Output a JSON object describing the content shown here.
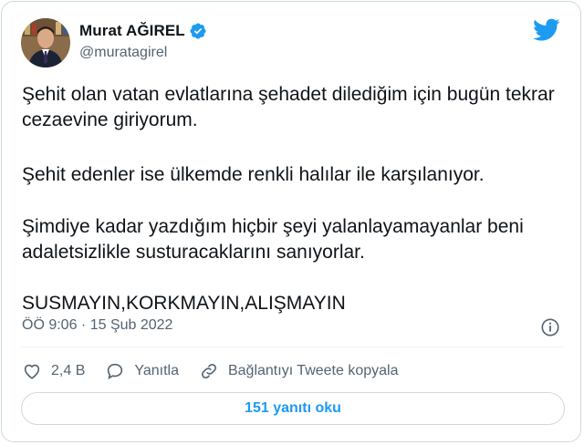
{
  "author": {
    "display_name": "Murat AĞIREL",
    "handle": "@muratagirel",
    "verified": true,
    "avatar_icon": "user-avatar-photo"
  },
  "brand": {
    "logo_icon": "twitter-bird-icon",
    "accent_color": "#1d9bf0"
  },
  "tweet": {
    "paragraphs": [
      "Şehit olan vatan evlatlarına şehadet dilediğim için bugün tekrar cezaevine giriyorum.",
      "Şehit edenler ise ülkemde renkli halılar ile karşılanıyor.",
      "Şimdiye kadar yazdığım hiçbir şeyi yalanlayamayanlar beni adaletsizlikle susturacaklarını sanıyorlar.",
      "SUSMAYIN,KORKMAYIN,ALIŞMAYIN"
    ],
    "timestamp": "ÖÖ 9:06 · 15 Şub 2022"
  },
  "actions": {
    "like_count": "2,4 B",
    "reply_label": "Yanıtla",
    "copy_link_label": "Bağlantıyı Tweete kopyala"
  },
  "replies_button": {
    "label": "151 yanıtı oku"
  }
}
